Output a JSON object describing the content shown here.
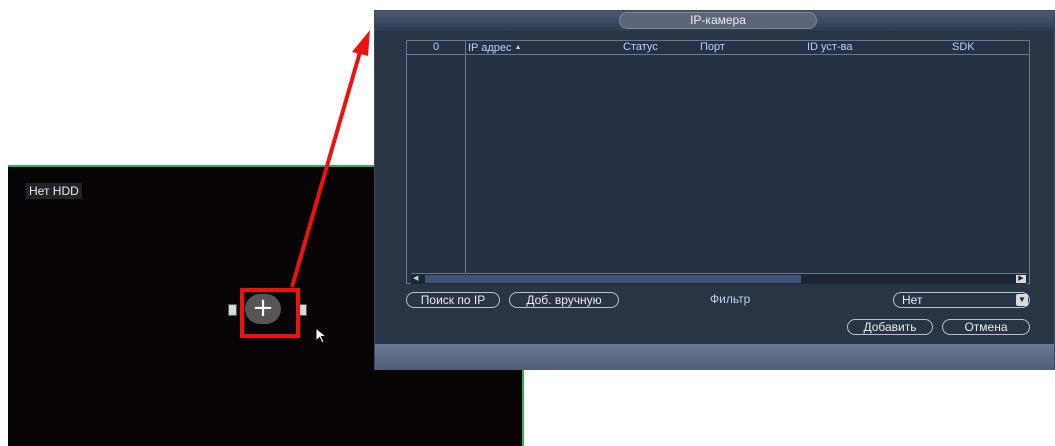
{
  "liveview": {
    "hdd_label": "Нет HDD"
  },
  "dialog": {
    "title": "IP-камера",
    "table": {
      "headers": {
        "index": "0",
        "ip": "IP адрес",
        "sort_indicator": "▲",
        "status": "Статус",
        "port": "Порт",
        "device_id": "ID уст-ва",
        "sdk": "SDK"
      },
      "rows": []
    },
    "buttons": {
      "search_ip": "Поиск по IP",
      "add_manual": "Доб. вручную",
      "add": "Добавить",
      "cancel": "Отмена"
    },
    "filter": {
      "label": "Фильтр",
      "value": "Нет"
    }
  },
  "colors": {
    "highlight": "#ee1111",
    "border_green": "#2bb34a",
    "dialog_bg": "#293445"
  },
  "icons": {
    "add_channel": "plus-icon",
    "cursor": "mouse-pointer-icon",
    "scroll_left": "arrow-left-icon",
    "scroll_right": "arrow-right-icon",
    "dropdown": "chevron-down-icon"
  }
}
